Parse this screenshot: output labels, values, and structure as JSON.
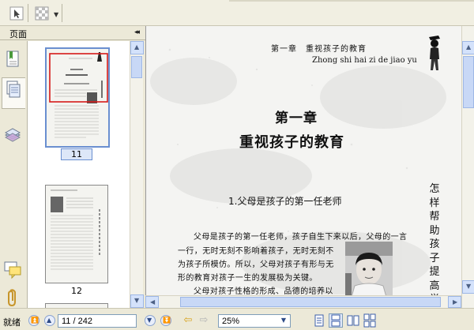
{
  "panel": {
    "tab_label": "页面",
    "collapse_glyph": "◂◂",
    "rail_icons": [
      "bookmark-icon",
      "pages-icon",
      "layers-icon",
      "comments-icon",
      "attachments-icon"
    ]
  },
  "thumbnails": [
    {
      "page_label": "11",
      "selected": true
    },
    {
      "page_label": "12",
      "selected": false
    }
  ],
  "document": {
    "running_head_cn": "第一章　重视孩子的教育",
    "running_head_pinyin": "Zhong shi hai zi de jiao yu",
    "chapter_number": "第一章",
    "chapter_title": "重视孩子的教育",
    "section_title": "1.父母是孩子的第一任老师",
    "body_lines": [
      "父母是孩子的第一任老师，孩子自生下来以后，父母的一言",
      "一行，无时无刻不影响着孩子，无时无刻不",
      "为孩子所模仿。所以，父母对孩子有形与无",
      "形的教育对孩子一生的发展极为关键。",
      "父母对孩子性格的形成、品德的培养以"
    ],
    "side_title": "怎样帮助孩子提高学"
  },
  "status": {
    "text": "就绪",
    "page_value": "11 / 242",
    "zoom_value": "25%"
  },
  "colors": {
    "accent": "#6a8fd0",
    "page_bg": "#f4f4f2",
    "chrome_bg": "#ece9d8"
  }
}
